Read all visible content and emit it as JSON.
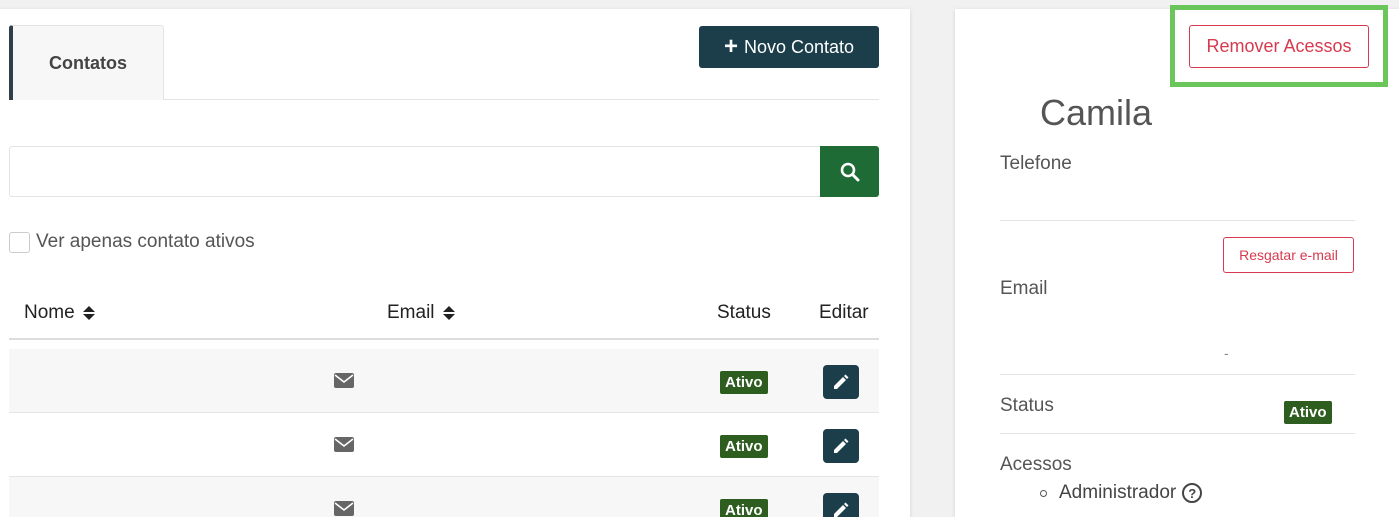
{
  "contacts_panel": {
    "tab_label": "Contatos",
    "new_contact_label": "Novo Contato",
    "search": {
      "value": "",
      "placeholder": ""
    },
    "filter_label": "Ver apenas contato ativos",
    "columns": {
      "name": "Nome",
      "email": "Email",
      "status": "Status",
      "edit": "Editar"
    },
    "rows": [
      {
        "status": "Ativo"
      },
      {
        "status": "Ativo"
      },
      {
        "status": "Ativo"
      }
    ]
  },
  "detail_panel": {
    "remove_access_label": "Remover Acessos",
    "name": "Camila",
    "phone_label": "Telefone",
    "email_label": "Email",
    "rescue_email_label": "Resgatar e-mail",
    "email_value": "-",
    "status_label": "Status",
    "status_value": "Ativo",
    "access_label": "Acessos",
    "access_items": [
      "Administrador"
    ]
  },
  "colors": {
    "primary_dark": "#1c3d4a",
    "search_green": "#1f6b35",
    "status_green": "#2e5e1f",
    "danger": "#d73a4e",
    "highlight": "#6ac55b"
  }
}
